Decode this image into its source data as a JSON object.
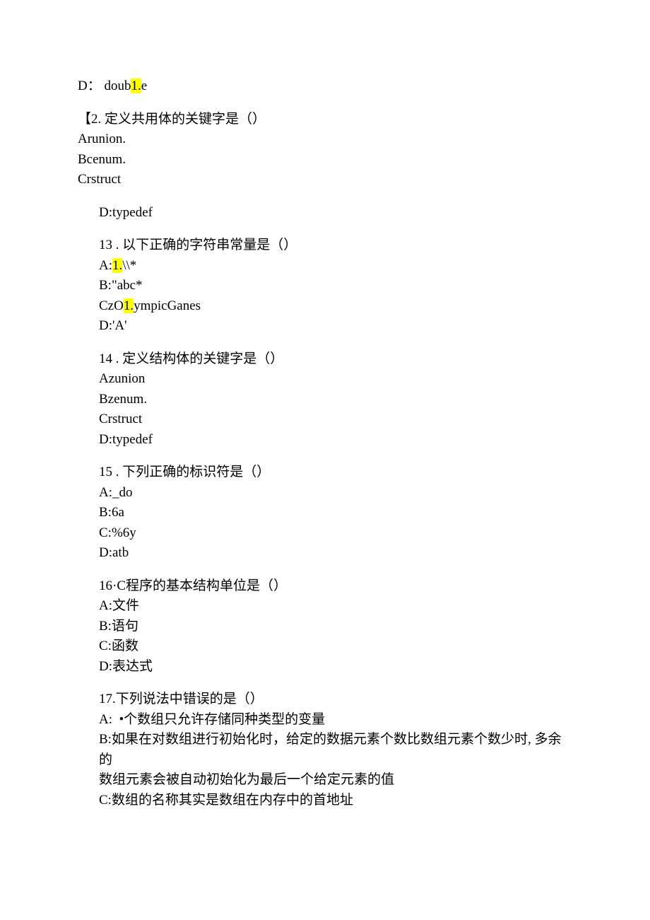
{
  "lines": [
    {
      "indent": 0,
      "spaceBefore": false,
      "parts": [
        {
          "t": "D： doub"
        },
        {
          "t": "1.",
          "hl": true
        },
        {
          "t": "e"
        }
      ]
    },
    {
      "indent": 0,
      "spaceBefore": true,
      "parts": [
        {
          "t": "【2. 定义共用体的关键字是（）"
        }
      ]
    },
    {
      "indent": 0,
      "spaceBefore": false,
      "parts": [
        {
          "t": "Arunion."
        }
      ]
    },
    {
      "indent": 0,
      "spaceBefore": false,
      "parts": [
        {
          "t": "Bcenum."
        }
      ]
    },
    {
      "indent": 0,
      "spaceBefore": false,
      "parts": [
        {
          "t": "Crstruct"
        }
      ]
    },
    {
      "indent": 1,
      "spaceBefore": true,
      "parts": [
        {
          "t": "D:typedef"
        }
      ]
    },
    {
      "indent": 1,
      "spaceBefore": true,
      "parts": [
        {
          "t": "13 . 以下正确的字符串常量是（）"
        }
      ]
    },
    {
      "indent": 1,
      "spaceBefore": false,
      "parts": [
        {
          "t": "A:"
        },
        {
          "t": "1.",
          "hl": true
        },
        {
          "t": "\\\\*"
        }
      ]
    },
    {
      "indent": 1,
      "spaceBefore": false,
      "parts": [
        {
          "t": "B:\"abc*"
        }
      ]
    },
    {
      "indent": 1,
      "spaceBefore": false,
      "parts": [
        {
          "t": "CzO"
        },
        {
          "t": "1.",
          "hl": true
        },
        {
          "t": "ympicGanes"
        }
      ]
    },
    {
      "indent": 1,
      "spaceBefore": false,
      "parts": [
        {
          "t": "D:'A'"
        }
      ]
    },
    {
      "indent": 1,
      "spaceBefore": true,
      "parts": [
        {
          "t": "14 . 定义结构体的关键字是（）"
        }
      ]
    },
    {
      "indent": 1,
      "spaceBefore": false,
      "parts": [
        {
          "t": "Azunion"
        }
      ]
    },
    {
      "indent": 1,
      "spaceBefore": false,
      "parts": [
        {
          "t": "Bzenum."
        }
      ]
    },
    {
      "indent": 1,
      "spaceBefore": false,
      "parts": [
        {
          "t": "Crstruct"
        }
      ]
    },
    {
      "indent": 1,
      "spaceBefore": false,
      "parts": [
        {
          "t": "D:typedef"
        }
      ]
    },
    {
      "indent": 1,
      "spaceBefore": true,
      "parts": [
        {
          "t": "15 . 下列正确的标识符是（）"
        }
      ]
    },
    {
      "indent": 1,
      "spaceBefore": false,
      "parts": [
        {
          "t": "A:_do"
        }
      ]
    },
    {
      "indent": 1,
      "spaceBefore": false,
      "parts": [
        {
          "t": "B:6a"
        }
      ]
    },
    {
      "indent": 1,
      "spaceBefore": false,
      "parts": [
        {
          "t": "C:%6y"
        }
      ]
    },
    {
      "indent": 1,
      "spaceBefore": false,
      "parts": [
        {
          "t": "D:atb"
        }
      ]
    },
    {
      "indent": 1,
      "spaceBefore": true,
      "parts": [
        {
          "t": "16·C程序的基本结构单位是（）"
        }
      ]
    },
    {
      "indent": 1,
      "spaceBefore": false,
      "parts": [
        {
          "t": "A:文件"
        }
      ]
    },
    {
      "indent": 1,
      "spaceBefore": false,
      "parts": [
        {
          "t": "B:语句"
        }
      ]
    },
    {
      "indent": 1,
      "spaceBefore": false,
      "parts": [
        {
          "t": "C:函数"
        }
      ]
    },
    {
      "indent": 1,
      "spaceBefore": false,
      "parts": [
        {
          "t": "D:表达式"
        }
      ]
    },
    {
      "indent": 1,
      "spaceBefore": true,
      "parts": [
        {
          "t": "17.下列说法中错误的是（）"
        }
      ]
    },
    {
      "indent": 1,
      "spaceBefore": false,
      "parts": [
        {
          "t": "A:  •个数组只允许存储同种类型的变量"
        }
      ]
    },
    {
      "indent": 1,
      "spaceBefore": false,
      "parts": [
        {
          "t": "B:如果在对数组进行初始化时，给定的数据元素个数比数组元素个数少时, 多余的"
        }
      ]
    },
    {
      "indent": 1,
      "spaceBefore": false,
      "parts": [
        {
          "t": "数组元素会被自动初始化为最后一个给定元素的值"
        }
      ]
    },
    {
      "indent": 1,
      "spaceBefore": false,
      "parts": [
        {
          "t": "C:数组的名称其实是数组在内存中的首地址"
        }
      ]
    }
  ]
}
